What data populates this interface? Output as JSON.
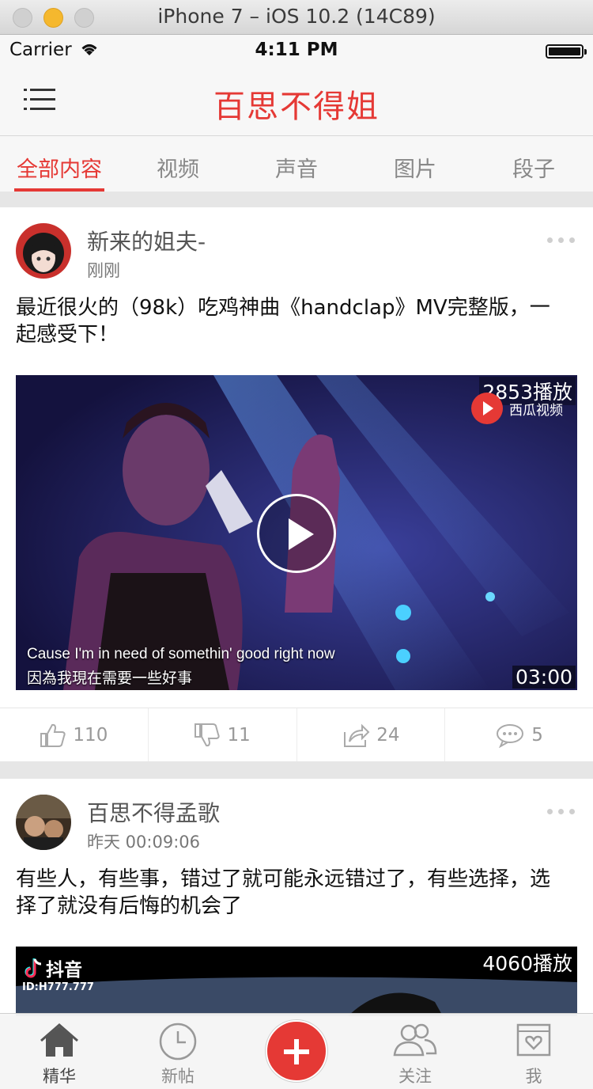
{
  "window": {
    "title": "iPhone 7 – iOS 10.2 (14C89)"
  },
  "status_bar": {
    "carrier": "Carrier",
    "time": "4:11 PM"
  },
  "nav": {
    "title": "百思不得姐"
  },
  "tabs": [
    {
      "label": "全部内容",
      "active": true
    },
    {
      "label": "视频",
      "active": false
    },
    {
      "label": "声音",
      "active": false
    },
    {
      "label": "图片",
      "active": false
    },
    {
      "label": "段子",
      "active": false
    }
  ],
  "posts": [
    {
      "user": "新来的姐夫-",
      "time": "刚刚",
      "text": "最近很火的（98k）吃鸡神曲《handclap》MV完整版，一起感受下！",
      "play_count": "2853播放",
      "duration": "03:00",
      "watermark": "西瓜视频",
      "subtitle_en": "Cause I'm in need of somethin' good right now",
      "subtitle_zh": "因為我現在需要一些好事",
      "likes": "110",
      "dislikes": "11",
      "shares": "24",
      "comments": "5"
    },
    {
      "user": "百思不得孟歌",
      "time": "昨天 00:09:06",
      "text": "有些人，有些事，错过了就可能永远错过了，有些选择，选择了就没有后悔的机会了",
      "play_count": "4060播放",
      "watermark": "抖音",
      "watermark_id": "ID:H777.777"
    }
  ],
  "tab_bar": {
    "items": [
      {
        "label": "精华",
        "icon": "home-icon",
        "active": true
      },
      {
        "label": "新帖",
        "icon": "clock-icon",
        "active": false
      },
      {
        "label": "",
        "icon": "plus-icon",
        "active": false
      },
      {
        "label": "关注",
        "icon": "people-icon",
        "active": false
      },
      {
        "label": "我",
        "icon": "profile-icon",
        "active": false
      }
    ]
  },
  "colors": {
    "accent": "#e53935"
  }
}
